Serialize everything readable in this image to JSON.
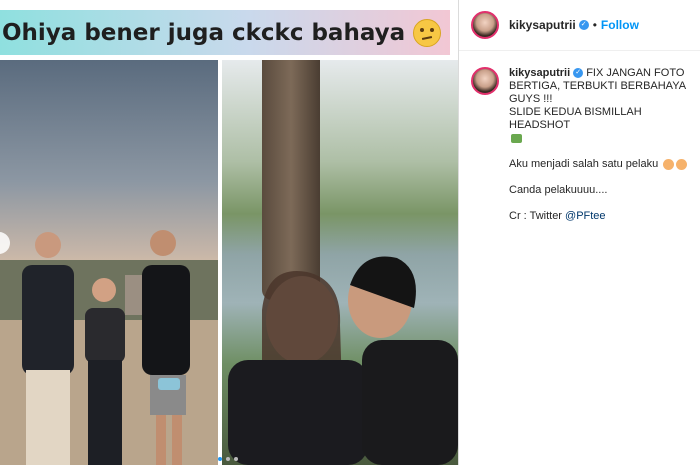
{
  "post": {
    "banner_text": "Ohiya bener juga ckckc bahaya",
    "banner_emoji": "thinking-face-emoji",
    "carousel": {
      "count": 3,
      "active_index": 0
    }
  },
  "sidebar": {
    "username": "kikysaputrii",
    "verified_mark": "✓",
    "separator": "•",
    "follow_label": "Follow",
    "caption": {
      "username": "kikysaputrii",
      "line1": "FIX JANGAN FOTO BERTIGA, TERBUKTI BERBAHAYA GUYS !!!",
      "line2": "SLIDE KEDUA BISMILLAH HEADSHOT",
      "line3": "Aku menjadi salah satu pelaku",
      "line4": "Canda pelakuuuu....",
      "credit_prefix": "Cr : Twitter ",
      "credit_handle": "@PFtee"
    }
  }
}
